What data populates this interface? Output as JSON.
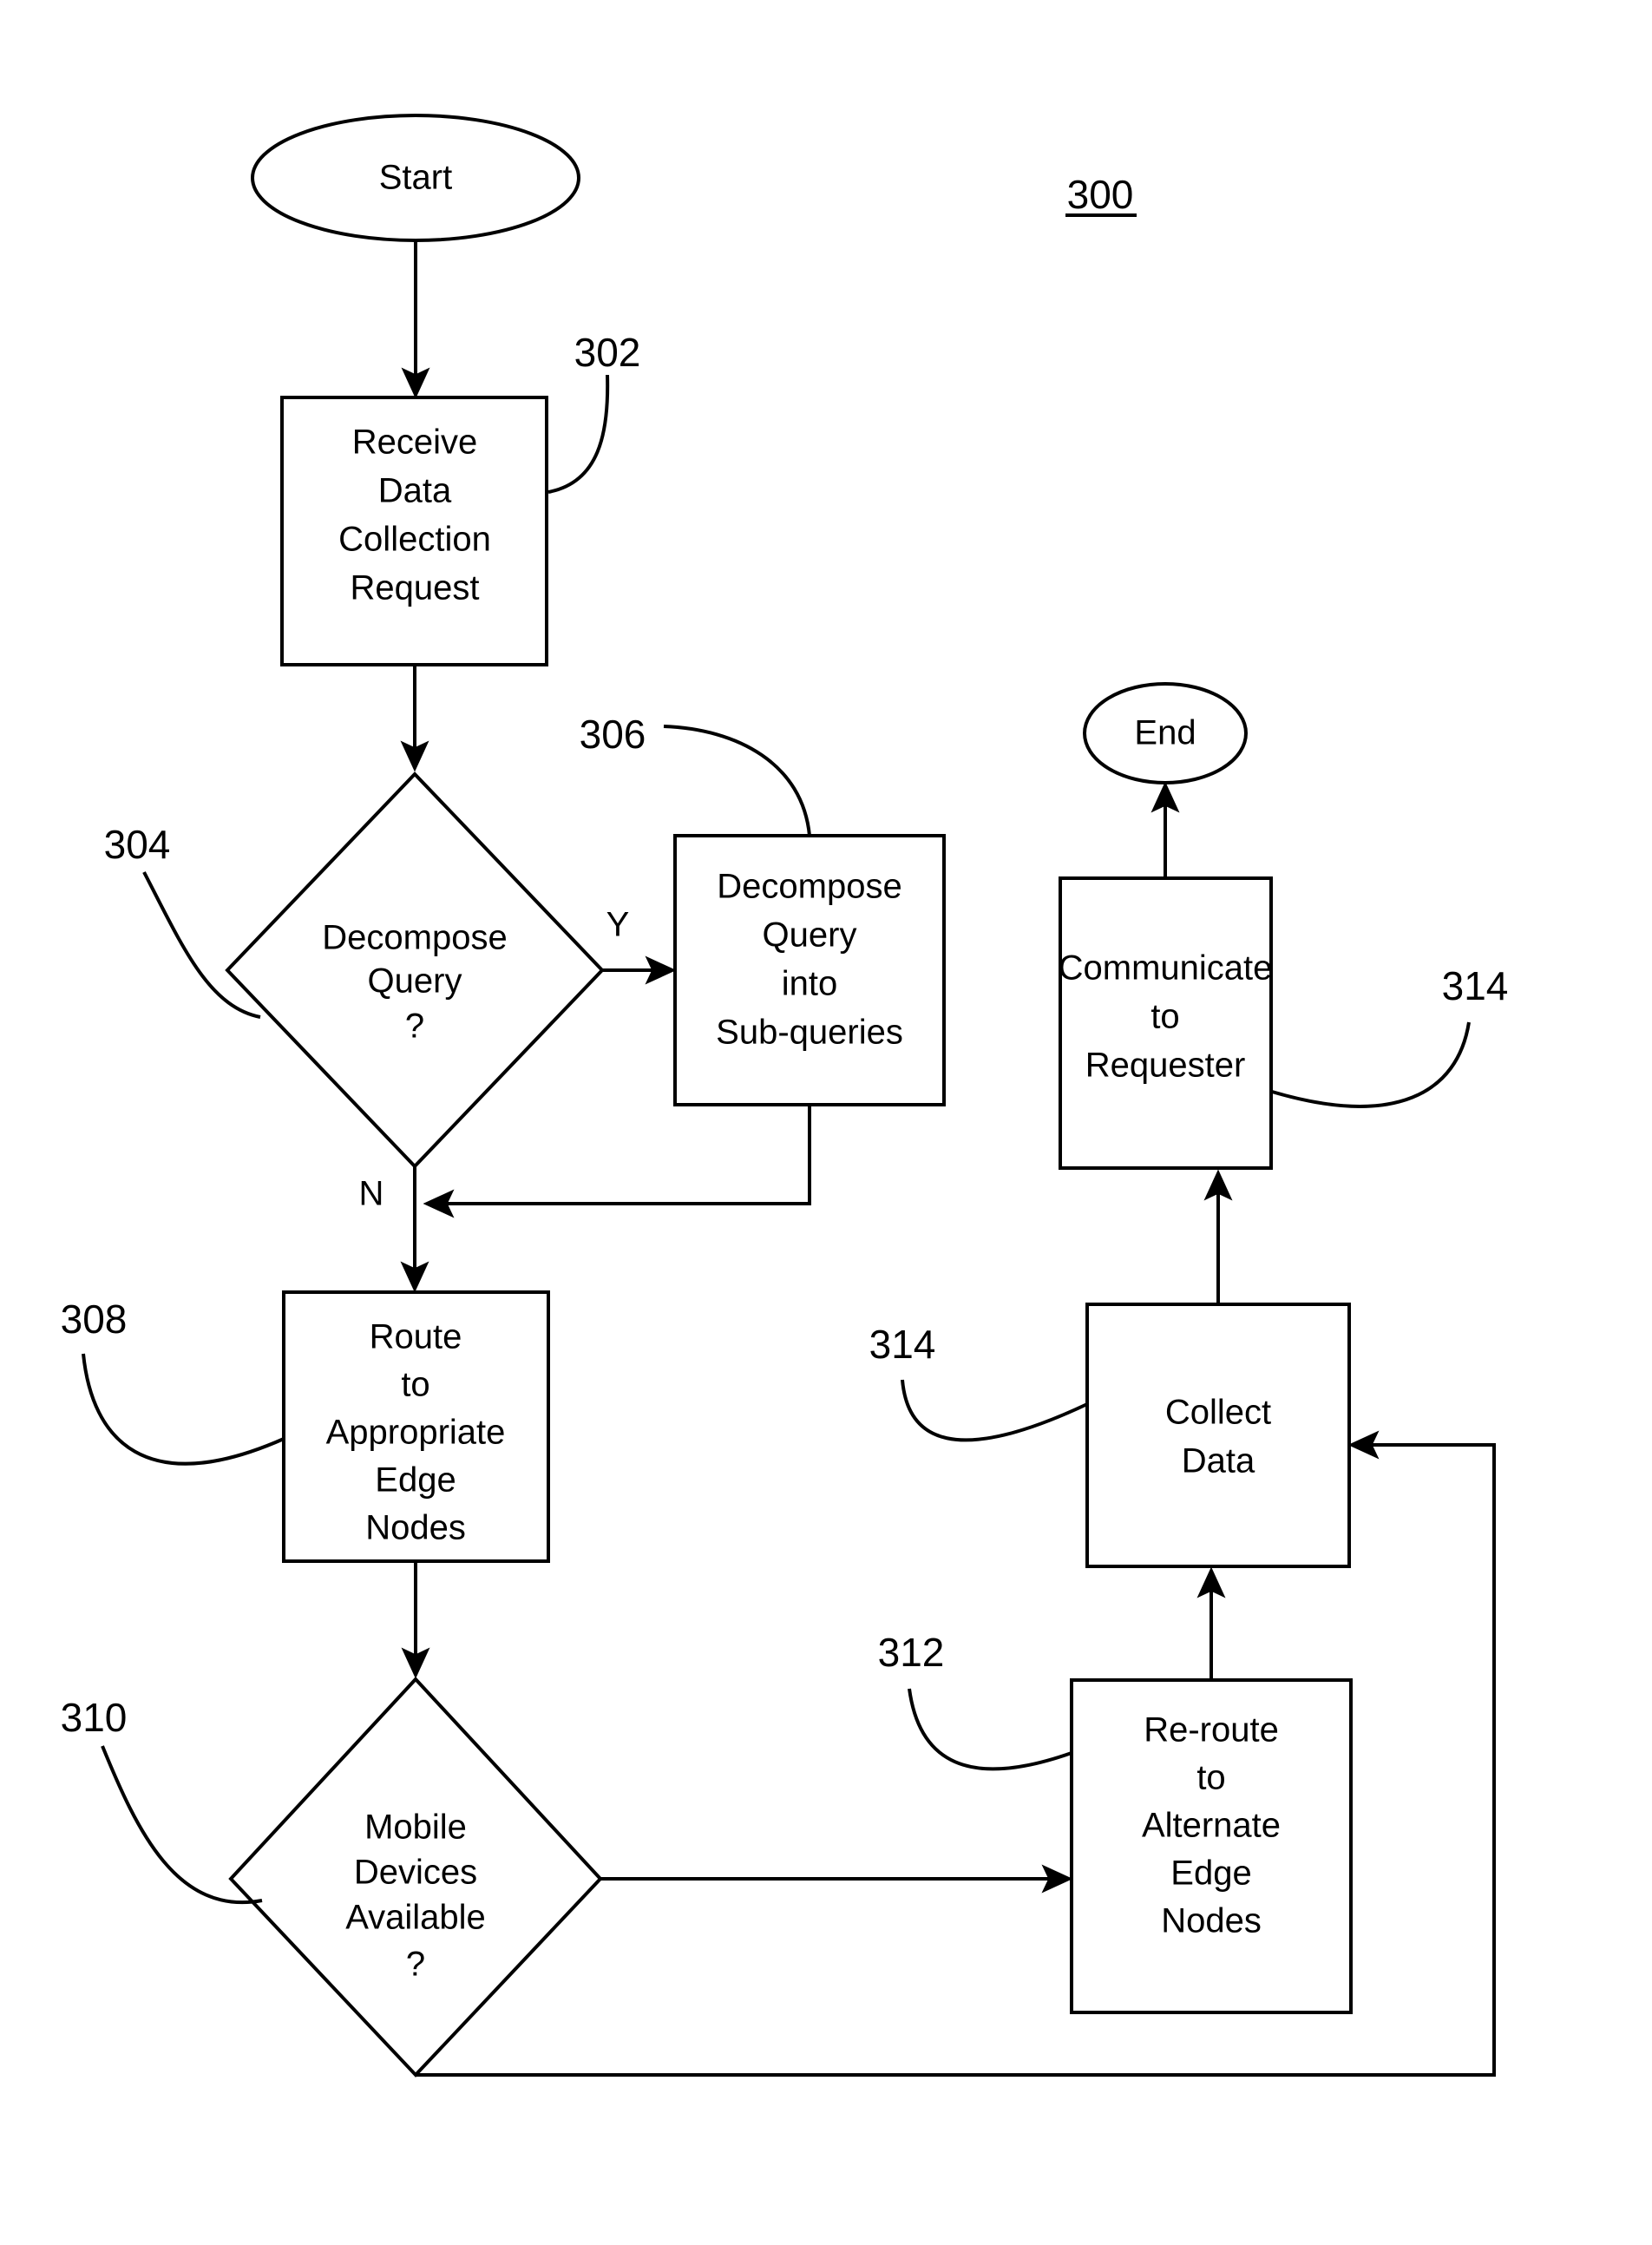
{
  "figure": {
    "number": "300",
    "type": "flowchart",
    "background_color": "#ffffff",
    "line_color": "#000000"
  },
  "nodes": [
    {
      "id": "start",
      "shape": "terminator",
      "label": "Start",
      "ref": null,
      "lines": [
        "Start"
      ]
    },
    {
      "id": "receive",
      "shape": "process",
      "ref": "302",
      "lines": [
        "Receive",
        "Data",
        "Collection",
        "Request"
      ]
    },
    {
      "id": "decompose_decision",
      "shape": "decision",
      "ref": "304",
      "lines": [
        "Decompose",
        "Query",
        "?"
      ]
    },
    {
      "id": "decompose_action",
      "shape": "process",
      "ref": "306",
      "lines": [
        "Decompose",
        "Query",
        "into",
        "Sub-queries"
      ]
    },
    {
      "id": "route",
      "shape": "process",
      "ref": "308",
      "lines": [
        "Route",
        "to",
        "Appropriate",
        "Edge",
        "Nodes"
      ]
    },
    {
      "id": "mobile_decision",
      "shape": "decision",
      "ref": "310",
      "lines": [
        "Mobile",
        "Devices",
        "Available",
        "?"
      ]
    },
    {
      "id": "reroute",
      "shape": "process",
      "ref": "312",
      "lines": [
        "Re-route",
        "to",
        "Alternate",
        "Edge",
        "Nodes"
      ]
    },
    {
      "id": "collect",
      "shape": "process",
      "ref": "314",
      "lines": [
        "Collect",
        "Data"
      ]
    },
    {
      "id": "communicate",
      "shape": "process",
      "ref": "314",
      "lines": [
        "Communicate",
        "to",
        "Requester"
      ]
    },
    {
      "id": "end",
      "shape": "terminator",
      "ref": null,
      "lines": [
        "End"
      ]
    }
  ],
  "branch_labels": {
    "yes": "Y",
    "no": "N"
  },
  "reference_numerals": {
    "figure": "300",
    "receive": "302",
    "decompose_decision": "304",
    "decompose_action": "306",
    "route": "308",
    "mobile_decision": "310",
    "reroute": "312",
    "collect": "314",
    "communicate": "314"
  },
  "text": {
    "start": "Start",
    "end": "End",
    "receive_l1": "Receive",
    "receive_l2": "Data",
    "receive_l3": "Collection",
    "receive_l4": "Request",
    "dec_l1": "Decompose",
    "dec_l2": "Query",
    "dec_l3": "?",
    "sub_l1": "Decompose",
    "sub_l2": "Query",
    "sub_l3": "into",
    "sub_l4": "Sub-queries",
    "route_l1": "Route",
    "route_l2": "to",
    "route_l3": "Appropriate",
    "route_l4": "Edge",
    "route_l5": "Nodes",
    "mob_l1": "Mobile",
    "mob_l2": "Devices",
    "mob_l3": "Available",
    "mob_l4": "?",
    "rer_l1": "Re-route",
    "rer_l2": "to",
    "rer_l3": "Alternate",
    "rer_l4": "Edge",
    "rer_l5": "Nodes",
    "col_l1": "Collect",
    "col_l2": "Data",
    "com_l1": "Communicate",
    "com_l2": "to",
    "com_l3": "Requester",
    "label_y": "Y",
    "label_n": "N",
    "ref_300": "300",
    "ref_302": "302",
    "ref_304": "304",
    "ref_306": "306",
    "ref_308": "308",
    "ref_310": "310",
    "ref_312": "312",
    "ref_314_collect": "314",
    "ref_314_comm": "314"
  },
  "edges": [
    {
      "from": "start",
      "to": "receive",
      "label": null
    },
    {
      "from": "receive",
      "to": "decompose_decision",
      "label": null
    },
    {
      "from": "decompose_decision",
      "to": "decompose_action",
      "label": "Y"
    },
    {
      "from": "decompose_decision",
      "to": "route",
      "label": "N"
    },
    {
      "from": "decompose_action",
      "to": "route",
      "label": null
    },
    {
      "from": "route",
      "to": "mobile_decision",
      "label": null
    },
    {
      "from": "mobile_decision",
      "to": "reroute",
      "label": null
    },
    {
      "from": "mobile_decision",
      "to": "collect",
      "label": null
    },
    {
      "from": "reroute",
      "to": "collect",
      "label": null
    },
    {
      "from": "collect",
      "to": "communicate",
      "label": null
    },
    {
      "from": "communicate",
      "to": "end",
      "label": null
    }
  ]
}
